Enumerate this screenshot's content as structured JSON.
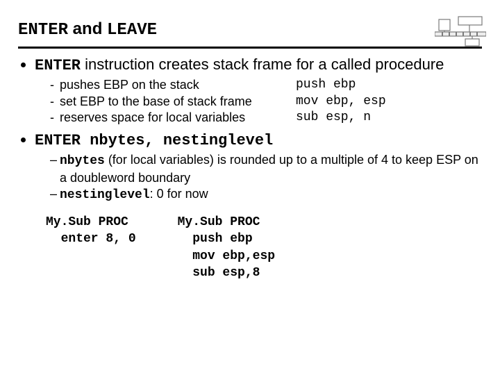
{
  "title": {
    "kw1": "ENTER",
    "mid": " and ",
    "kw2": "LEAVE"
  },
  "b1": {
    "kw": "ENTER",
    "rest": " instruction creates stack frame for a called procedure",
    "subs": [
      {
        "text": "pushes EBP on the stack",
        "code": "push ebp"
      },
      {
        "text": "set EBP to the base of stack frame",
        "code": "mov ebp, esp"
      },
      {
        "text": "reserves space for local variables",
        "code": "sub esp, n"
      }
    ]
  },
  "b2": {
    "sig": "ENTER nbytes, nestinglevel",
    "s1": {
      "kw": "nbytes",
      "rest": " (for local variables) is rounded up to a multiple of 4 to keep ESP on a doubleword boundary"
    },
    "s2": {
      "kw": "nestinglevel",
      "rest": ": 0 for now"
    }
  },
  "code": {
    "left": "My.Sub PROC\n  enter 8, 0",
    "right": "My.Sub PROC\n  push ebp\n  mov ebp,esp\n  sub esp,8"
  }
}
